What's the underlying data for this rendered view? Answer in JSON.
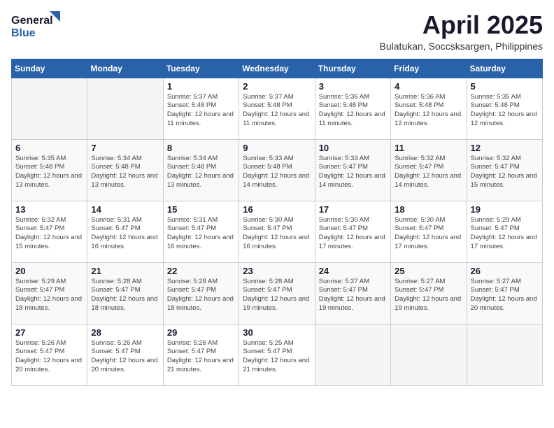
{
  "logo": {
    "general": "General",
    "blue": "Blue"
  },
  "title": {
    "month_year": "April 2025",
    "location": "Bulatukan, Soccsksargen, Philippines"
  },
  "days_of_week": [
    "Sunday",
    "Monday",
    "Tuesday",
    "Wednesday",
    "Thursday",
    "Friday",
    "Saturday"
  ],
  "weeks": [
    [
      {
        "day": "",
        "detail": ""
      },
      {
        "day": "",
        "detail": ""
      },
      {
        "day": "1",
        "detail": "Sunrise: 5:37 AM\nSunset: 5:48 PM\nDaylight: 12 hours and 11 minutes."
      },
      {
        "day": "2",
        "detail": "Sunrise: 5:37 AM\nSunset: 5:48 PM\nDaylight: 12 hours and 11 minutes."
      },
      {
        "day": "3",
        "detail": "Sunrise: 5:36 AM\nSunset: 5:48 PM\nDaylight: 12 hours and 11 minutes."
      },
      {
        "day": "4",
        "detail": "Sunrise: 5:36 AM\nSunset: 5:48 PM\nDaylight: 12 hours and 12 minutes."
      },
      {
        "day": "5",
        "detail": "Sunrise: 5:35 AM\nSunset: 5:48 PM\nDaylight: 12 hours and 12 minutes."
      }
    ],
    [
      {
        "day": "6",
        "detail": "Sunrise: 5:35 AM\nSunset: 5:48 PM\nDaylight: 12 hours and 13 minutes."
      },
      {
        "day": "7",
        "detail": "Sunrise: 5:34 AM\nSunset: 5:48 PM\nDaylight: 12 hours and 13 minutes."
      },
      {
        "day": "8",
        "detail": "Sunrise: 5:34 AM\nSunset: 5:48 PM\nDaylight: 12 hours and 13 minutes."
      },
      {
        "day": "9",
        "detail": "Sunrise: 5:33 AM\nSunset: 5:48 PM\nDaylight: 12 hours and 14 minutes."
      },
      {
        "day": "10",
        "detail": "Sunrise: 5:33 AM\nSunset: 5:47 PM\nDaylight: 12 hours and 14 minutes."
      },
      {
        "day": "11",
        "detail": "Sunrise: 5:32 AM\nSunset: 5:47 PM\nDaylight: 12 hours and 14 minutes."
      },
      {
        "day": "12",
        "detail": "Sunrise: 5:32 AM\nSunset: 5:47 PM\nDaylight: 12 hours and 15 minutes."
      }
    ],
    [
      {
        "day": "13",
        "detail": "Sunrise: 5:32 AM\nSunset: 5:47 PM\nDaylight: 12 hours and 15 minutes."
      },
      {
        "day": "14",
        "detail": "Sunrise: 5:31 AM\nSunset: 5:47 PM\nDaylight: 12 hours and 16 minutes."
      },
      {
        "day": "15",
        "detail": "Sunrise: 5:31 AM\nSunset: 5:47 PM\nDaylight: 12 hours and 16 minutes."
      },
      {
        "day": "16",
        "detail": "Sunrise: 5:30 AM\nSunset: 5:47 PM\nDaylight: 12 hours and 16 minutes."
      },
      {
        "day": "17",
        "detail": "Sunrise: 5:30 AM\nSunset: 5:47 PM\nDaylight: 12 hours and 17 minutes."
      },
      {
        "day": "18",
        "detail": "Sunrise: 5:30 AM\nSunset: 5:47 PM\nDaylight: 12 hours and 17 minutes."
      },
      {
        "day": "19",
        "detail": "Sunrise: 5:29 AM\nSunset: 5:47 PM\nDaylight: 12 hours and 17 minutes."
      }
    ],
    [
      {
        "day": "20",
        "detail": "Sunrise: 5:29 AM\nSunset: 5:47 PM\nDaylight: 12 hours and 18 minutes."
      },
      {
        "day": "21",
        "detail": "Sunrise: 5:28 AM\nSunset: 5:47 PM\nDaylight: 12 hours and 18 minutes."
      },
      {
        "day": "22",
        "detail": "Sunrise: 5:28 AM\nSunset: 5:47 PM\nDaylight: 12 hours and 18 minutes."
      },
      {
        "day": "23",
        "detail": "Sunrise: 5:28 AM\nSunset: 5:47 PM\nDaylight: 12 hours and 19 minutes."
      },
      {
        "day": "24",
        "detail": "Sunrise: 5:27 AM\nSunset: 5:47 PM\nDaylight: 12 hours and 19 minutes."
      },
      {
        "day": "25",
        "detail": "Sunrise: 5:27 AM\nSunset: 5:47 PM\nDaylight: 12 hours and 19 minutes."
      },
      {
        "day": "26",
        "detail": "Sunrise: 5:27 AM\nSunset: 5:47 PM\nDaylight: 12 hours and 20 minutes."
      }
    ],
    [
      {
        "day": "27",
        "detail": "Sunrise: 5:26 AM\nSunset: 5:47 PM\nDaylight: 12 hours and 20 minutes."
      },
      {
        "day": "28",
        "detail": "Sunrise: 5:26 AM\nSunset: 5:47 PM\nDaylight: 12 hours and 20 minutes."
      },
      {
        "day": "29",
        "detail": "Sunrise: 5:26 AM\nSunset: 5:47 PM\nDaylight: 12 hours and 21 minutes."
      },
      {
        "day": "30",
        "detail": "Sunrise: 5:25 AM\nSunset: 5:47 PM\nDaylight: 12 hours and 21 minutes."
      },
      {
        "day": "",
        "detail": ""
      },
      {
        "day": "",
        "detail": ""
      },
      {
        "day": "",
        "detail": ""
      }
    ]
  ]
}
